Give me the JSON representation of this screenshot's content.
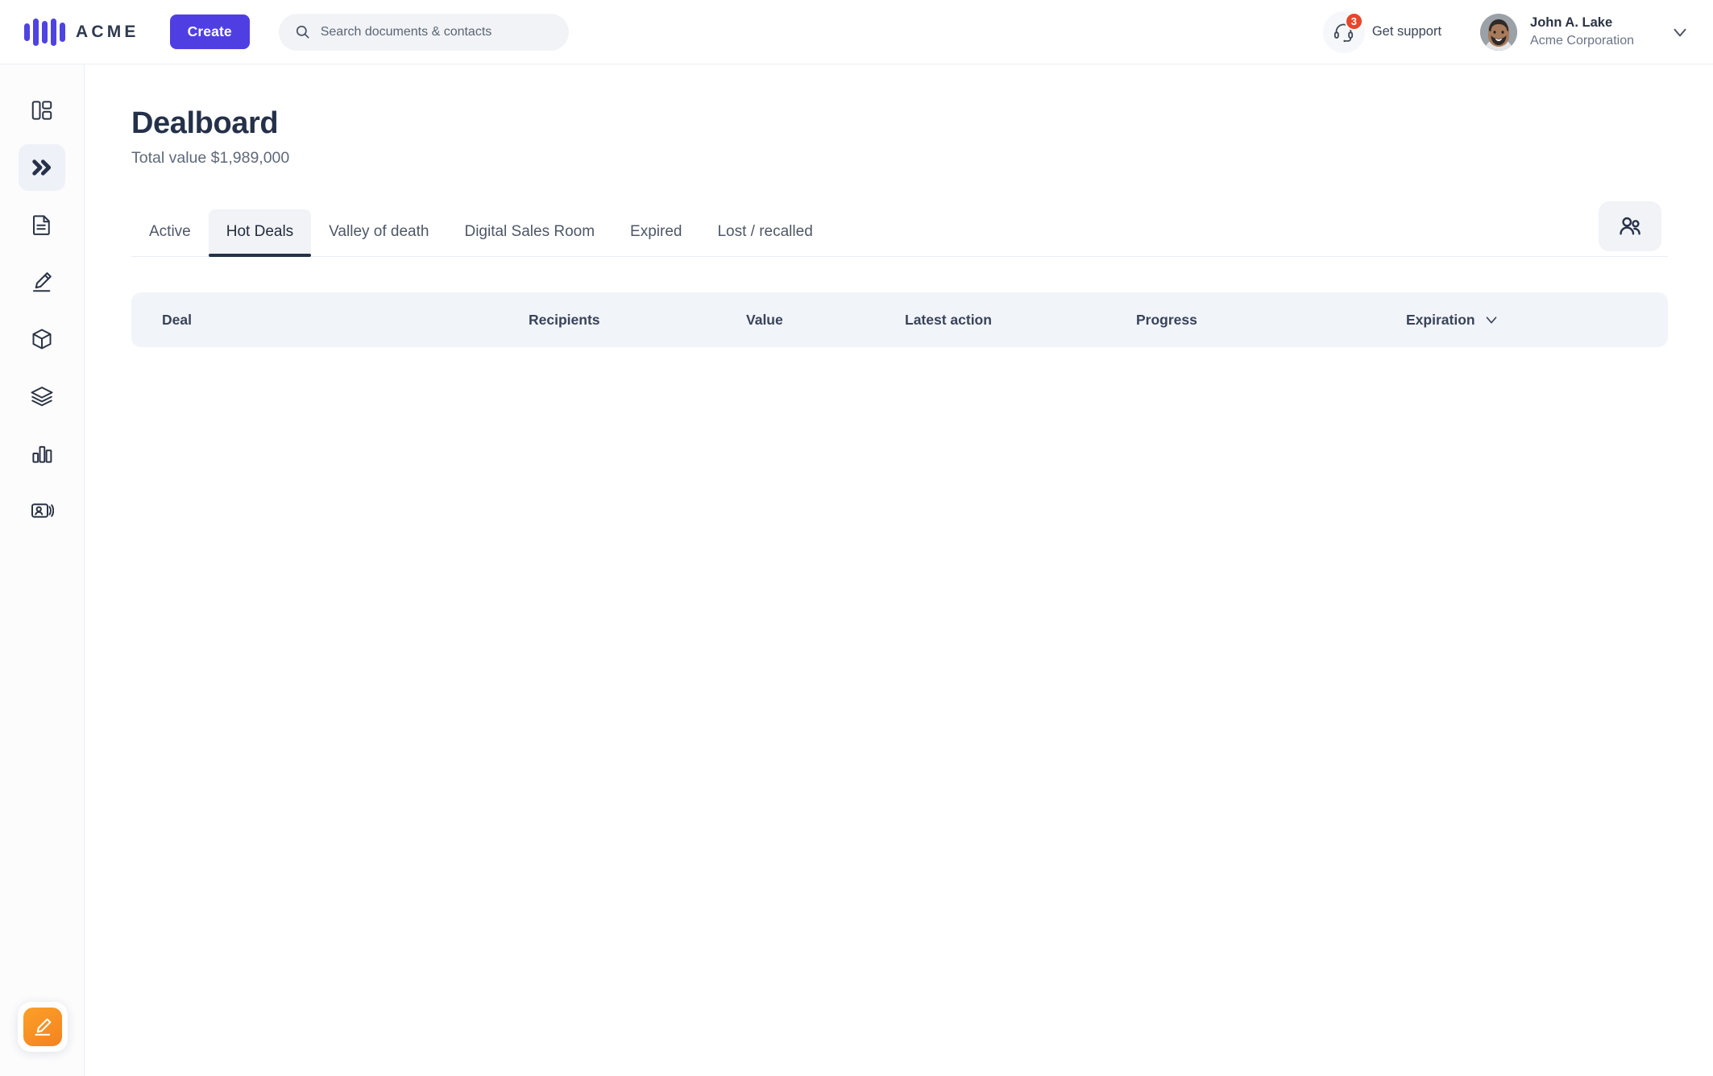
{
  "topbar": {
    "brand_name": "ACME",
    "brand_icon": "acme-bars-logo",
    "create_label": "Create",
    "search": {
      "placeholder": "Search documents & contacts",
      "value": "",
      "icon": "search-icon"
    },
    "support": {
      "label": "Get support",
      "badge_count": "3",
      "icon": "headset-icon"
    },
    "account": {
      "name": "John A. Lake",
      "org": "Acme Corporation",
      "avatar_icon": "user-avatar-photo",
      "caret_icon": "chevron-down-icon"
    }
  },
  "sidebar": {
    "items": [
      {
        "name": "dashboard-icon",
        "label": "Dashboard",
        "active": false
      },
      {
        "name": "double-chevron-icon",
        "label": "Dealboard",
        "active": true
      },
      {
        "name": "document-icon",
        "label": "Documents",
        "active": false
      },
      {
        "name": "signature-pen-icon",
        "label": "Signatures",
        "active": false
      },
      {
        "name": "cube-icon",
        "label": "Products",
        "active": false
      },
      {
        "name": "layers-icon",
        "label": "Templates",
        "active": false
      },
      {
        "name": "bar-chart-icon",
        "label": "Analytics",
        "active": false
      },
      {
        "name": "contact-card-icon",
        "label": "Contacts",
        "active": false
      }
    ],
    "fab": {
      "icon": "signature-pen-icon",
      "label": "Sign"
    }
  },
  "main": {
    "title": "Dealboard",
    "subtitle": "Total value $1,989,000",
    "tabs": [
      {
        "label": "Active",
        "active": false
      },
      {
        "label": "Hot Deals",
        "active": true
      },
      {
        "label": "Valley of death",
        "active": false
      },
      {
        "label": "Digital Sales Room",
        "active": false
      },
      {
        "label": "Expired",
        "active": false
      },
      {
        "label": "Lost / recalled",
        "active": false
      }
    ],
    "team_button": {
      "icon": "people-icon",
      "label": "Team"
    },
    "table": {
      "columns": [
        {
          "label": "Deal",
          "sort_icon": ""
        },
        {
          "label": "Recipients",
          "sort_icon": ""
        },
        {
          "label": "Value",
          "sort_icon": ""
        },
        {
          "label": "Latest action",
          "sort_icon": ""
        },
        {
          "label": "Progress",
          "sort_icon": ""
        },
        {
          "label": "Expiration",
          "sort_icon": "chevron-down-icon"
        }
      ],
      "rows": [],
      "empty": true
    }
  },
  "colors": {
    "brand_purple": "#4f3fe2",
    "badge_red": "#e8452a",
    "fab_orange": "#f5821f",
    "active_underline": "#26324a",
    "panel_gray": "#f1f4f9"
  }
}
